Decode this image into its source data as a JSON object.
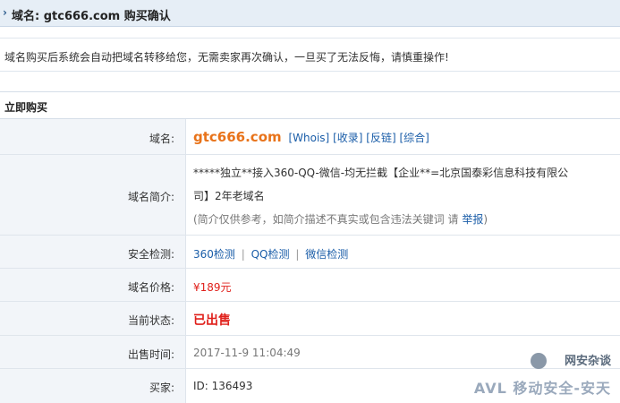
{
  "header": {
    "title": "域名: gtc666.com 购买确认"
  },
  "notice": "域名购买后系统会自动把域名转移给您，无需卖家再次确认，一旦买了无法反悔，请慎重操作!",
  "section": {
    "title": "立即购买"
  },
  "rows": {
    "domain": {
      "label": "域名:",
      "value": "gtc666.com",
      "links": [
        "[Whois]",
        "[收录]",
        "[反链]",
        "[综合]"
      ]
    },
    "intro": {
      "label": "域名简介:",
      "line1": "*****独立**接入360-QQ-微信-均无拦截【企业**=北京国泰彩信息科技有限公",
      "line2": "司】2年老域名",
      "note": "(简介仅供参考，如简介描述不真实或包含违法关键词 请",
      "report": "举报",
      "note_end": ")"
    },
    "security": {
      "label": "安全检测:",
      "links": [
        "360检测",
        "QQ检测",
        "微信检测"
      ],
      "separator": "|"
    },
    "price": {
      "label": "域名价格:",
      "value": "¥189元"
    },
    "status": {
      "label": "当前状态:",
      "value": "已出售"
    },
    "sold_time": {
      "label": "出售时间:",
      "value": "2017-11-9 11:04:49"
    },
    "buyer": {
      "label": "买家:",
      "value": "ID: 136493"
    }
  },
  "watermark": {
    "line1": "网安杂谈",
    "line2": "AVL 移动安全-安天"
  },
  "colors": {
    "header_bg": "#e6eef6",
    "label_bg": "#f2f5f9",
    "domain": "#e8731a",
    "link": "#1a5da8",
    "alert": "#e0201b"
  }
}
